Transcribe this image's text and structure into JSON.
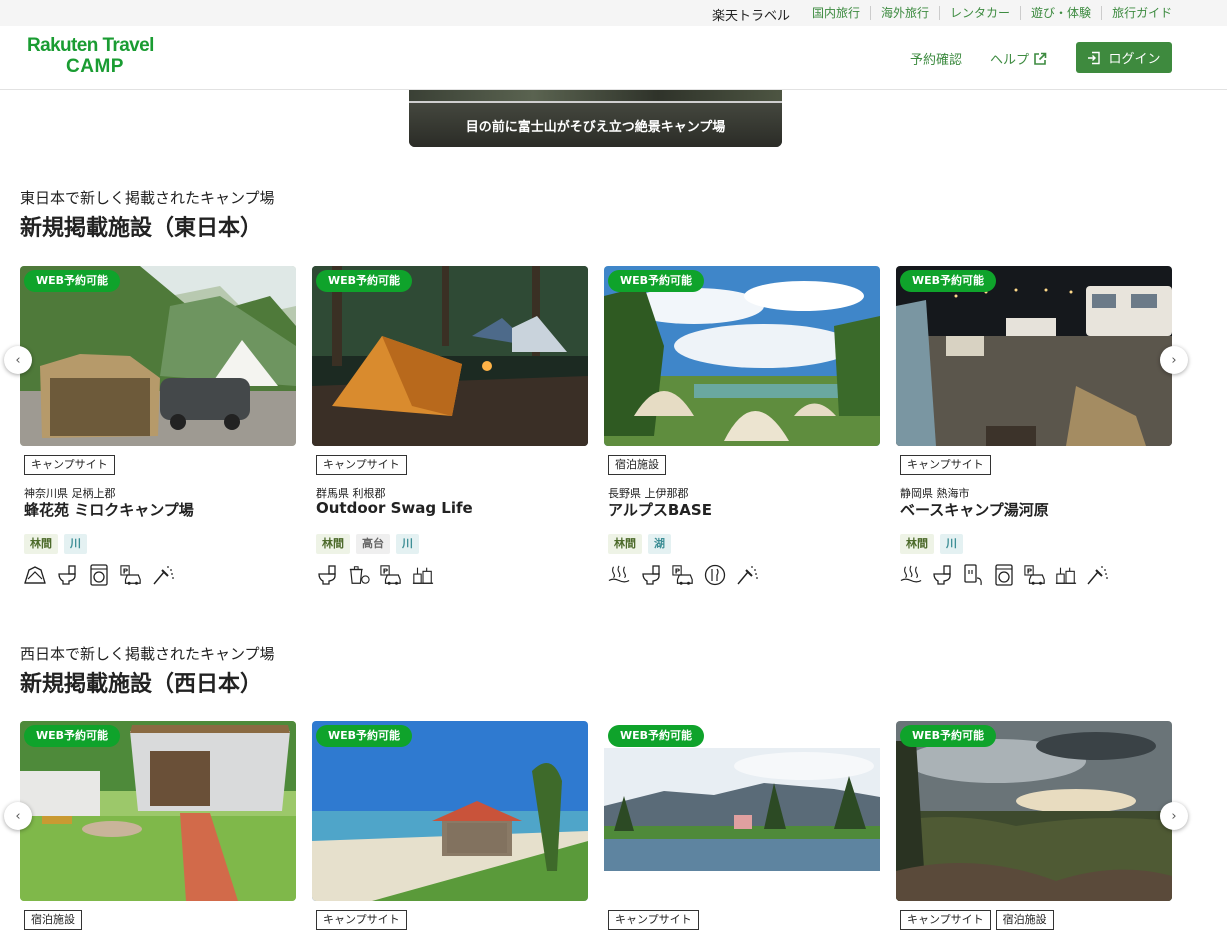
{
  "util_bar": {
    "brand": "楽天トラベル",
    "links": [
      "国内旅行",
      "海外旅行",
      "レンタカー",
      "遊び・体験",
      "旅行ガイド"
    ]
  },
  "header": {
    "logo_line1": "Rakuten Travel",
    "logo_line2": "CAMP",
    "reservation_label": "予約確認",
    "help_label": "ヘルプ",
    "login_label": "ログイン"
  },
  "banner": {
    "caption": "目の前に富士山がそびえ立つ絶景キャンプ場"
  },
  "sections": [
    {
      "subtitle": "東日本で新しく掲載されたキャンプ場",
      "title": "新規掲載施設（東日本）",
      "cards": [
        {
          "badge": "WEB予約可能",
          "categories": [
            "キャンプサイト"
          ],
          "location": "神奈川県 足柄上郡",
          "name": "蜂花苑 ミロクキャンプ場",
          "features": [
            {
              "label": "林間",
              "tone": "g"
            },
            {
              "label": "川",
              "tone": "b"
            }
          ],
          "amenities": [
            "tent-site-icon",
            "toilet-icon",
            "washing-machine-icon",
            "parking-icon",
            "shower-icon"
          ]
        },
        {
          "badge": "WEB予約可能",
          "categories": [
            "キャンプサイト"
          ],
          "location": "群馬県 利根郡",
          "name": "Outdoor Swag Life",
          "features": [
            {
              "label": "林間",
              "tone": "g"
            },
            {
              "label": "高台",
              "tone": "gr"
            },
            {
              "label": "川",
              "tone": "b"
            }
          ],
          "amenities": [
            "toilet-icon",
            "trash-icon",
            "parking-icon",
            "rental-icon"
          ]
        },
        {
          "badge": "WEB予約可能",
          "categories": [
            "宿泊施設"
          ],
          "location": "長野県 上伊那郡",
          "name": "アルプスBASE",
          "features": [
            {
              "label": "林間",
              "tone": "g"
            },
            {
              "label": "湖",
              "tone": "b"
            }
          ],
          "amenities": [
            "hot-spring-icon",
            "toilet-icon",
            "parking-icon",
            "restaurant-icon",
            "shower-icon"
          ]
        },
        {
          "badge": "WEB予約可能",
          "categories": [
            "キャンプサイト"
          ],
          "location": "静岡県 熱海市",
          "name": "ベースキャンプ湯河原",
          "features": [
            {
              "label": "林間",
              "tone": "g"
            },
            {
              "label": "川",
              "tone": "b"
            }
          ],
          "amenities": [
            "hot-spring-icon",
            "toilet-icon",
            "power-outlet-icon",
            "washing-machine-icon",
            "parking-icon",
            "rental-icon",
            "shower-icon"
          ]
        }
      ]
    },
    {
      "subtitle": "西日本で新しく掲載されたキャンプ場",
      "title": "新規掲載施設（西日本）",
      "cards": [
        {
          "badge": "WEB予約可能",
          "categories": [
            "宿泊施設"
          ]
        },
        {
          "badge": "WEB予約可能",
          "categories": [
            "キャンプサイト"
          ]
        },
        {
          "badge": "WEB予約可能",
          "categories": [
            "キャンプサイト"
          ]
        },
        {
          "badge": "WEB予約可能",
          "categories": [
            "キャンプサイト",
            "宿泊施設"
          ]
        }
      ]
    }
  ],
  "colors": {
    "brand_green": "#1a9c32",
    "link_green": "#3d8b40",
    "login_bg": "#3e8a3e",
    "web_badge": "#0fa32b"
  }
}
